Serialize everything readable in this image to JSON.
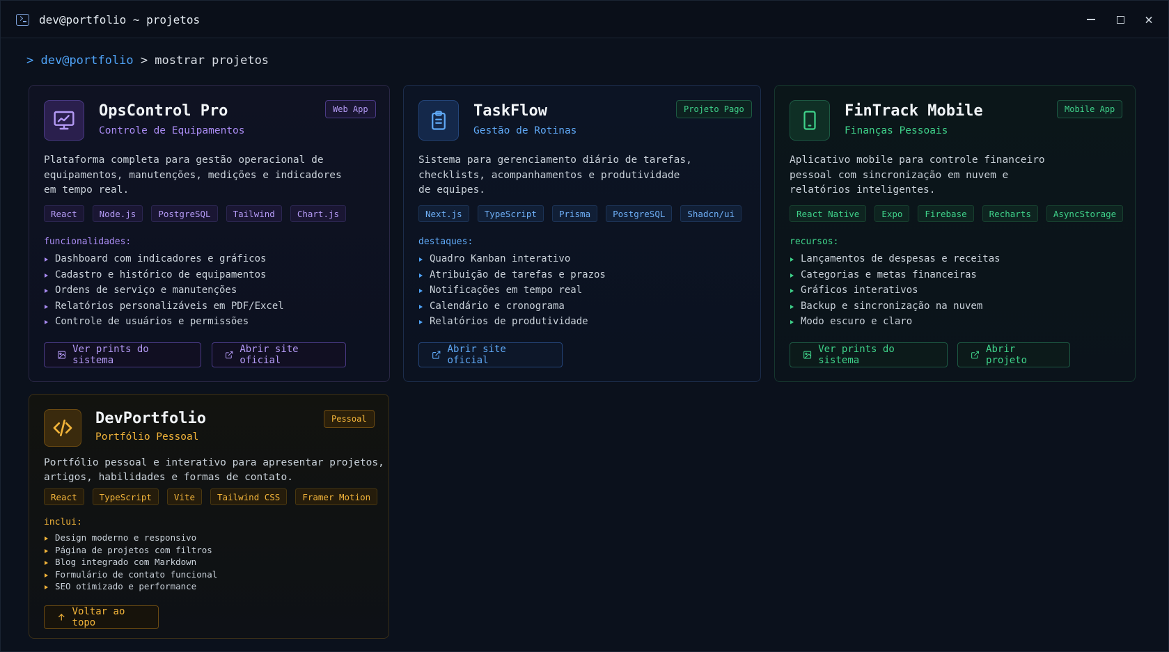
{
  "window": {
    "title": "dev@portfolio ~ projetos",
    "close_glyph": "×"
  },
  "prompt": {
    "chevron": ">",
    "user": "dev@portfolio",
    "command": "> mostrar projetos"
  },
  "cards": [
    {
      "title": "OpsControl Pro",
      "subtitle": "Controle de Equipamentos",
      "badge": "Web App",
      "icon": "monitor-chart-icon",
      "accent": "#a98bf2",
      "description": "Plataforma completa para gestão operacional de\nequipamentos, manutenções, medições e indicadores\nem tempo real.",
      "tags": [
        "React",
        "Node.js",
        "PostgreSQL",
        "Tailwind",
        "Chart.js"
      ],
      "section_label": "funcionalidades:",
      "features": [
        "Dashboard com indicadores e gráficos",
        "Cadastro e histórico de equipamentos",
        "Ordens de serviço e manutenções",
        "Relatórios personalizáveis em PDF/Excel",
        "Controle de usuários e permissões"
      ],
      "buttons": [
        {
          "label": "Ver prints do sistema",
          "icon": "image-icon"
        },
        {
          "label": "Abrir site oficial",
          "icon": "external-link-icon"
        }
      ]
    },
    {
      "title": "TaskFlow",
      "subtitle": "Gestão de Rotinas",
      "badge": "Projeto Pago",
      "icon": "clipboard-icon",
      "accent": "#4fa3f7",
      "description": "Sistema para gerenciamento diário de tarefas,\nchecklists, acompanhamentos e produtividade\nde equipes.",
      "tags": [
        "Next.js",
        "TypeScript",
        "Prisma",
        "PostgreSQL",
        "Shadcn/ui"
      ],
      "section_label": "destaques:",
      "features": [
        "Quadro Kanban interativo",
        "Atribuição de tarefas e prazos",
        "Notificações em tempo real",
        "Calendário e cronograma",
        "Relatórios de produtividade"
      ],
      "buttons": [
        {
          "label": "Abrir site oficial",
          "icon": "external-link-icon"
        }
      ]
    },
    {
      "title": "FinTrack Mobile",
      "subtitle": "Finanças Pessoais",
      "badge": "Mobile App",
      "icon": "smartphone-icon",
      "accent": "#3fd28a",
      "description": "Aplicativo mobile para controle financeiro\npessoal com sincronização em nuvem e\nrelatórios inteligentes.",
      "tags": [
        "React Native",
        "Expo",
        "Firebase",
        "Recharts",
        "AsyncStorage"
      ],
      "section_label": "recursos:",
      "features": [
        "Lançamentos de despesas e receitas",
        "Categorias e metas financeiras",
        "Gráficos interativos",
        "Backup e sincronização na nuvem",
        "Modo escuro e claro"
      ],
      "buttons": [
        {
          "label": "Ver prints do sistema",
          "icon": "image-icon"
        },
        {
          "label": "Abrir projeto",
          "icon": "external-link-icon"
        }
      ]
    },
    {
      "title": "DevPortfolio",
      "subtitle": "Portfólio Pessoal",
      "badge": "Pessoal",
      "icon": "code-icon",
      "accent": "#f2b43a",
      "description": "Portfólio pessoal e interativo para apresentar projetos,\nartigos, habilidades e formas de contato.",
      "tags": [
        "React",
        "TypeScript",
        "Vite",
        "Tailwind CSS",
        "Framer Motion"
      ],
      "section_label": "inclui:",
      "features": [
        "Design moderno e responsivo",
        "Página de projetos com filtros",
        "Blog integrado com Markdown",
        "Formulário de contato funcional",
        "SEO otimizado e performance"
      ],
      "buttons": [
        {
          "label": "Voltar ao topo",
          "icon": "arrow-up-icon"
        }
      ]
    }
  ]
}
